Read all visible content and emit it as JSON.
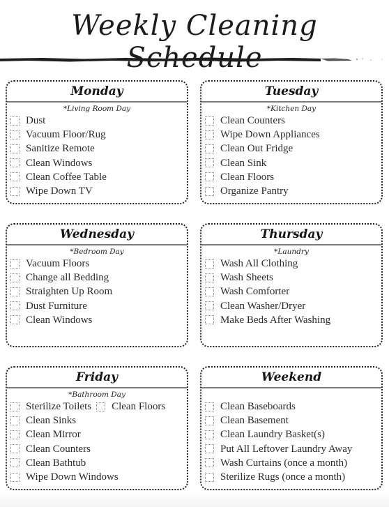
{
  "title": "Weekly Cleaning Schedule",
  "icons": {
    "checkbox": "empty-checkbox-icon",
    "divider": "brush-stroke-divider"
  },
  "days": [
    {
      "name": "Monday",
      "subtitle": "*Living Room Day",
      "tasks": [
        "Dust",
        "Vacuum Floor/Rug",
        "Sanitize Remote",
        "Clean Windows",
        "Clean Coffee Table",
        "Wipe Down TV"
      ]
    },
    {
      "name": "Tuesday",
      "subtitle": "*Kitchen Day",
      "tasks": [
        "Clean Counters",
        "Wipe Down Appliances",
        "Clean Out Fridge",
        "Clean Sink",
        "Clean Floors",
        "Organize Pantry"
      ]
    },
    {
      "name": "Wednesday",
      "subtitle": "*Bedroom Day",
      "tasks": [
        "Vacuum Floors",
        "Change all Bedding",
        "Straighten Up Room",
        "Dust Furniture",
        "Clean Windows"
      ]
    },
    {
      "name": "Thursday",
      "subtitle": "*Laundry",
      "tasks": [
        "Wash All Clothing",
        "Wash Sheets",
        "Wash Comforter",
        "Clean Washer/Dryer",
        "Make Beds After Washing"
      ]
    },
    {
      "name": "Friday",
      "subtitle": "*Bathroom Day",
      "tasks": [
        "Sterilize Toilets",
        "Clean Floors",
        "Clean Sinks",
        "Clean Mirror",
        "Clean Counters",
        "Clean Bathtub",
        "Wipe Down Windows"
      ]
    },
    {
      "name": "Weekend",
      "subtitle": "",
      "tasks": [
        "Clean Baseboards",
        "Clean Basement",
        "Clean Laundry Basket(s)",
        "Put All Leftover Laundry Away",
        "Wash Curtains (once a month)",
        "Sterilize Rugs (once a month)"
      ]
    }
  ]
}
